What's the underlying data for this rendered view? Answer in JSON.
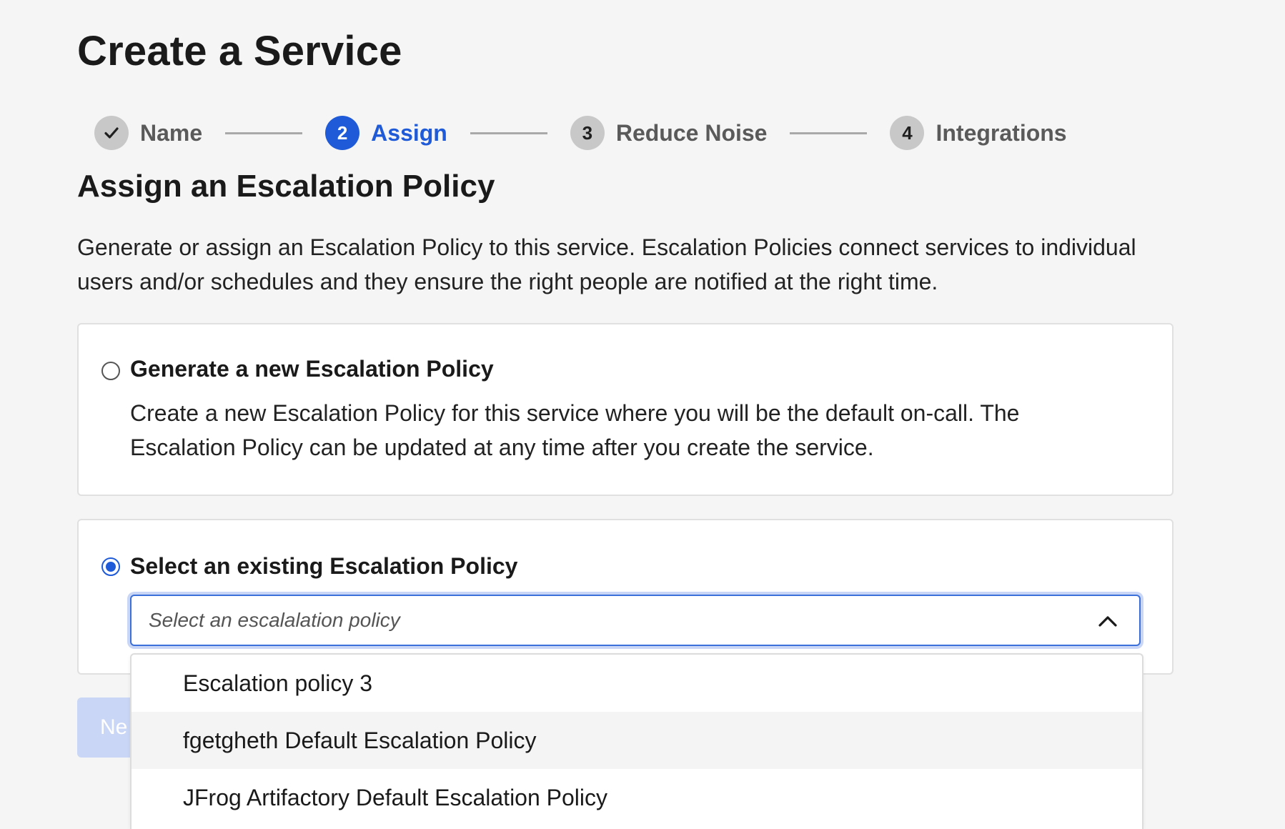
{
  "page": {
    "title": "Create a Service"
  },
  "stepper": {
    "steps": [
      {
        "number": "✓",
        "label": "Name",
        "state": "complete"
      },
      {
        "number": "2",
        "label": "Assign",
        "state": "active"
      },
      {
        "number": "3",
        "label": "Reduce Noise",
        "state": "upcoming"
      },
      {
        "number": "4",
        "label": "Integrations",
        "state": "upcoming"
      }
    ]
  },
  "section": {
    "title": "Assign an Escalation Policy",
    "description": "Generate or assign an Escalation Policy to this service. Escalation Policies connect services to individual users and/or schedules and they ensure the right people are notified at the right time."
  },
  "options": {
    "generate": {
      "title": "Generate a new Escalation Policy",
      "description": "Create a new Escalation Policy for this service where you will be the default on-call. The Escalation Policy can be updated at any time after you create the service.",
      "selected": false
    },
    "existing": {
      "title": "Select an existing Escalation Policy",
      "selected": true,
      "select_placeholder": "Select an escalalation policy"
    }
  },
  "dropdown": {
    "items": [
      "Escalation policy 3",
      "fgetgheth Default Escalation Policy",
      "JFrog Artifactory Default Escalation Policy"
    ],
    "hovered_index": 1
  },
  "next_button": {
    "label": "Ne"
  },
  "colors": {
    "accent": "#1f5bd8",
    "background": "#f5f5f5",
    "step_inactive": "#c8c8c8",
    "button_disabled": "#c9d6f6"
  },
  "icons": {
    "step_complete": "check-icon",
    "select_toggle": "chevron-up-icon"
  }
}
